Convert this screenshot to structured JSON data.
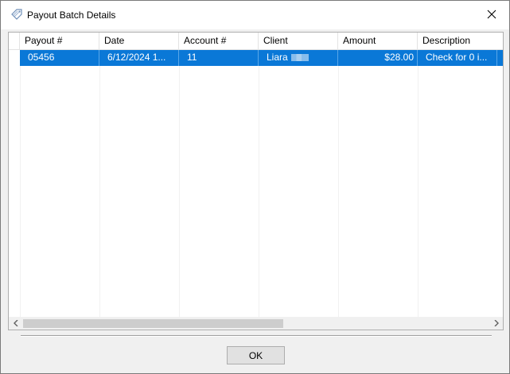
{
  "window": {
    "title": "Payout Batch Details",
    "icon": "tag-icon",
    "close_icon": "close-icon"
  },
  "grid": {
    "columns": [
      "Payout #",
      "Date",
      "Account #",
      "Client",
      "Amount",
      "Description"
    ],
    "rows": [
      {
        "payout": "05456",
        "date": "6/12/2024 1...",
        "account": "11",
        "client": "Liara",
        "amount": "$28.00",
        "description": "Check for 0 i..."
      }
    ],
    "selected_row_color": "#0a78d7"
  },
  "footer": {
    "ok_label": "OK"
  }
}
